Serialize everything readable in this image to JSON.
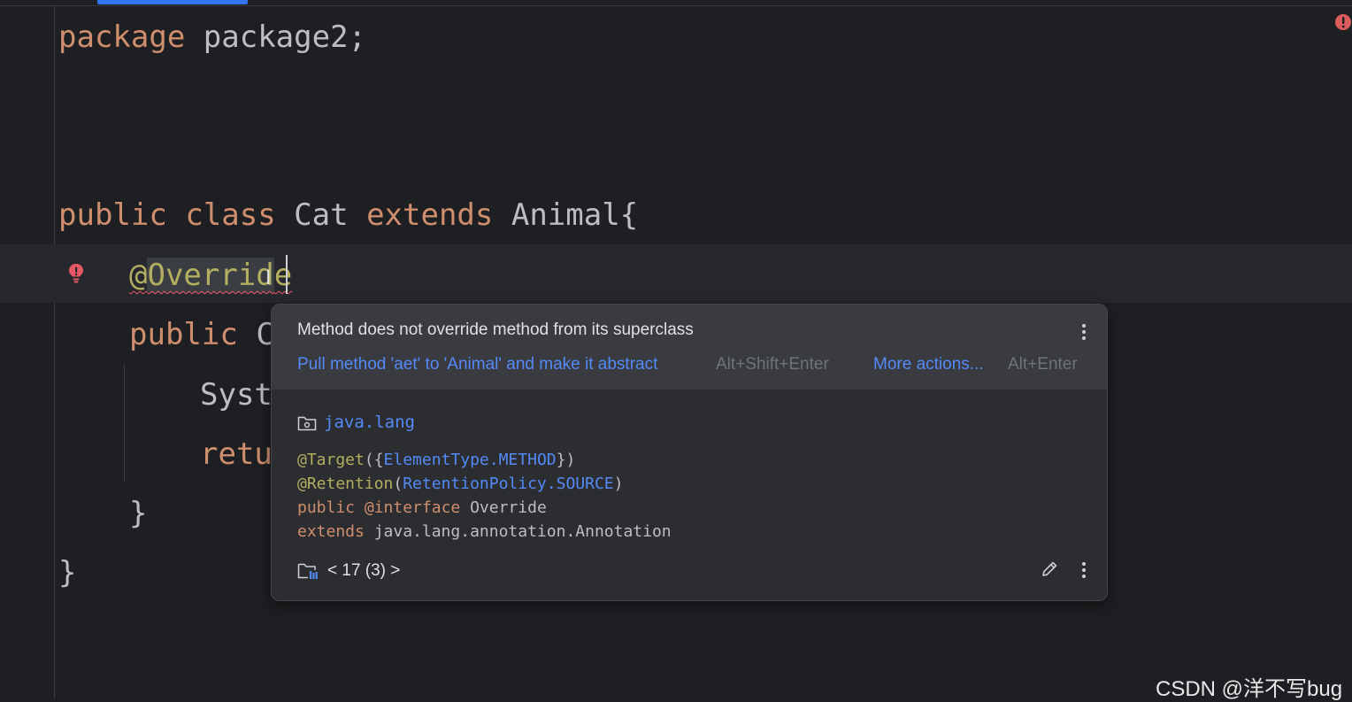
{
  "editor": {
    "lines": {
      "l1": {
        "kw": "package",
        "name": "package2;"
      },
      "l2": {
        "kw1": "public",
        "kw2": "class",
        "name": "Cat",
        "kw3": "extends",
        "parent": "Animal{"
      },
      "l3": {
        "at": "@",
        "anno_sel": "Overrid",
        "anno_tail": "e"
      },
      "l4": {
        "kw": "public",
        "tail": "C"
      },
      "l5": {
        "tail": "Syst"
      },
      "l6": {
        "tail": "retu"
      },
      "l7": {
        "brace": "}"
      },
      "l8": {
        "brace": "}"
      }
    }
  },
  "popup": {
    "message": "Method does not override method from its superclass",
    "fix_label": "Pull method 'aet' to 'Animal' and make it abstract",
    "fix_shortcut": "Alt+Shift+Enter",
    "more_label": "More actions...",
    "more_shortcut": "Alt+Enter",
    "package_name": "java.lang",
    "doc": {
      "line1": {
        "anno": "@Target",
        "p1": "({",
        "link": "ElementType.METHOD",
        "p2": "})"
      },
      "line2": {
        "anno": "@Retention",
        "p1": "(",
        "link": "RetentionPolicy.SOURCE",
        "p2": ")"
      },
      "line3": {
        "kw": "public",
        "kw2": "@interface",
        "name": "Override"
      },
      "line4": {
        "kw": "extends",
        "name": "java.lang.annotation.Annotation"
      }
    },
    "nav": "< 17 (3) >"
  },
  "colors": {
    "keyword": "#cf8e6d",
    "annotation": "#b3ae60",
    "link": "#548af7",
    "error": "#f75464",
    "accent": "#3574f0"
  },
  "watermark": "CSDN @洋不写bug"
}
